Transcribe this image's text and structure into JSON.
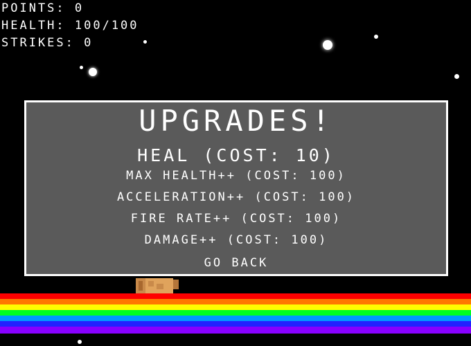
{
  "hud": {
    "points": "POINTS: 0",
    "health": "HEALTH: 100/100",
    "strikes": "STRIKES: 0"
  },
  "upgrades_menu": {
    "title": "UPGRADES!",
    "items": [
      {
        "label": "HEAL (COST: 10)"
      },
      {
        "label": "MAX HEALTH++ (COST: 100)"
      },
      {
        "label": "ACCELERATION++ (COST: 100)"
      },
      {
        "label": "FIRE RATE++ (COST: 100)"
      },
      {
        "label": "DAMAGE++ (COST: 100)"
      }
    ],
    "back_label": "GO BACK"
  },
  "colors": {
    "background": "#000000",
    "panel_fill": "#5a5a5a",
    "panel_border": "#ffffff",
    "text": "#ffffff",
    "rainbow": [
      "#ff0000",
      "#ff7a00",
      "#ffff00",
      "#00ff22",
      "#0099ff",
      "#2222ff",
      "#8800ff"
    ]
  }
}
